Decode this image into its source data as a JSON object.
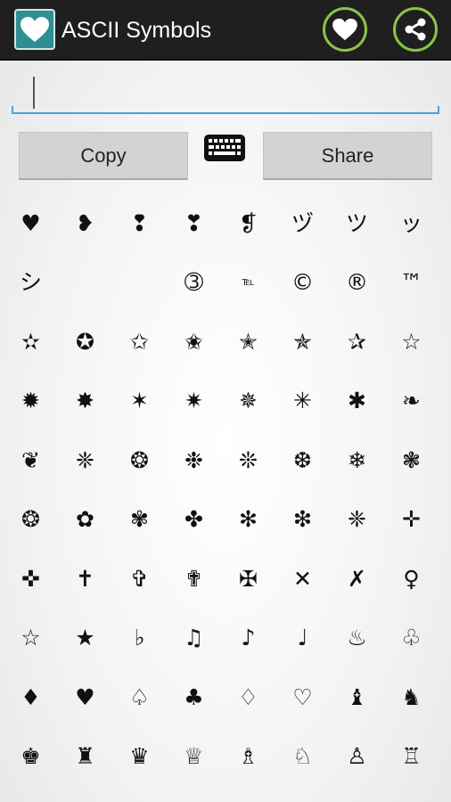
{
  "app": {
    "title": "ASCII Symbols",
    "icon": "heart-icon",
    "actions": [
      {
        "name": "favorite-button",
        "icon": "heart-icon"
      },
      {
        "name": "share-action-button",
        "icon": "share-icon"
      }
    ]
  },
  "input": {
    "value": "",
    "placeholder": ""
  },
  "buttons": {
    "copy": "Copy",
    "share": "Share",
    "keyboard_icon": "keyboard-icon"
  },
  "colors": {
    "accent_green": "#8bc34a",
    "action_bar": "#1f1f1f",
    "input_line": "#4aa3d6",
    "app_icon": "#2f8e94"
  },
  "symbols": [
    "♥",
    "❥",
    "❢",
    "❣",
    "❡",
    "ヅ",
    "ツ",
    "ッ",
    "シ",
    "",
    "",
    "➂",
    "℡",
    "©",
    "®",
    "™",
    "✫",
    "✪",
    "✩",
    "✬",
    "✭",
    "✯",
    "✰",
    "☆",
    "✹",
    "✸",
    "✶",
    "✷",
    "✵",
    "✳",
    "✱",
    "❧",
    "❦",
    "❈",
    "❂",
    "❉",
    "❊",
    "❆",
    "❄",
    "❃",
    "❂",
    "✿",
    "✾",
    "✤",
    "✻",
    "❇",
    "❈",
    "✛",
    "✜",
    "✝",
    "✞",
    "✟",
    "✠",
    "✕",
    "✗",
    "♀",
    "☆",
    "★",
    "♭",
    "♫",
    "♪",
    "♩",
    "♨",
    "♧",
    "♦",
    "♥",
    "♤",
    "♣",
    "♢",
    "♡",
    "♝",
    "♞",
    "♚",
    "♜",
    "♛",
    "♕",
    "♗",
    "♘",
    "♙",
    "♖"
  ]
}
